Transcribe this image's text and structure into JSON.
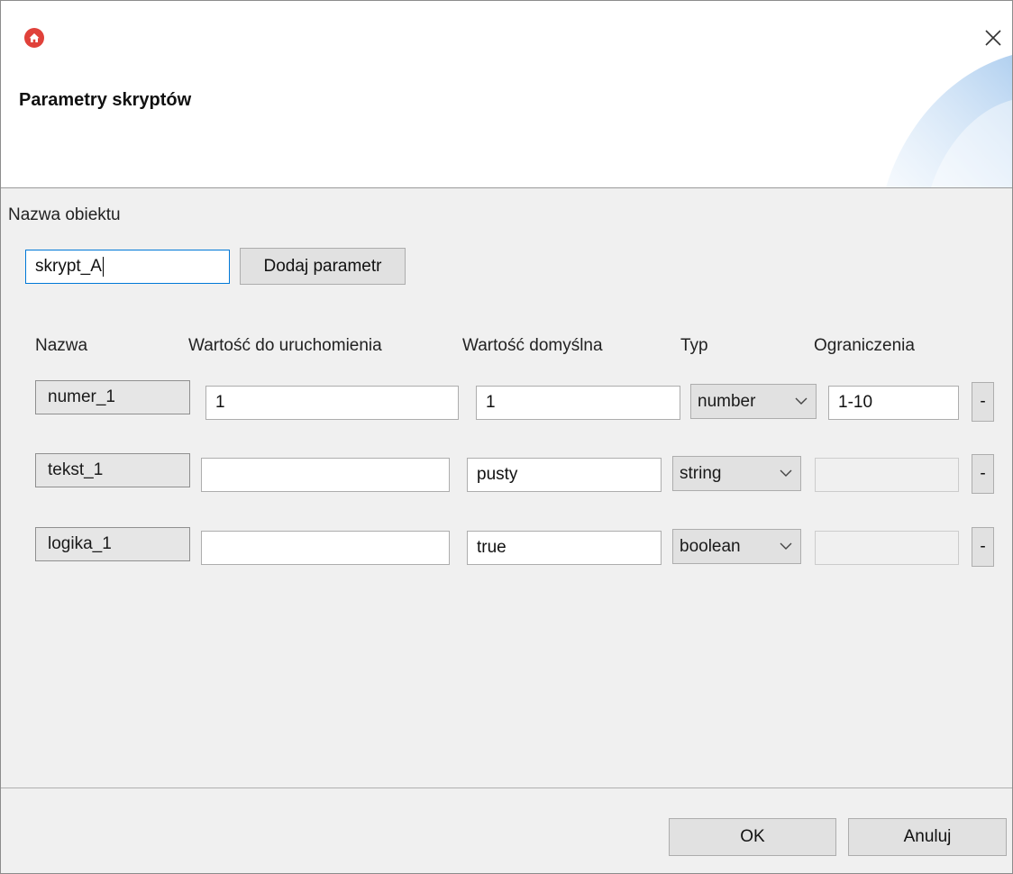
{
  "dialog": {
    "title": "Parametry skryptów",
    "close_glyph": "✕",
    "app_icon": "home-icon",
    "accent_color": "#e0413a"
  },
  "object": {
    "label": "Nazwa obiektu",
    "value": "skrypt_A",
    "add_button_label": "Dodaj parametr"
  },
  "columns": {
    "name": "Nazwa",
    "run_value": "Wartość do uruchomienia",
    "default_value": "Wartość domyślna",
    "type": "Typ",
    "constraints": "Ograniczenia"
  },
  "params": [
    {
      "name": "numer_1",
      "run_value": "1",
      "default_value": "1",
      "type": "number",
      "constraints": "1-10",
      "constraints_enabled": true,
      "remove_label": "-"
    },
    {
      "name": "tekst_1",
      "run_value": "",
      "default_value": "pusty",
      "type": "string",
      "constraints": "",
      "constraints_enabled": false,
      "remove_label": "-"
    },
    {
      "name": "logika_1",
      "run_value": "",
      "default_value": "true",
      "type": "boolean",
      "constraints": "",
      "constraints_enabled": false,
      "remove_label": "-"
    }
  ],
  "footer": {
    "ok_label": "OK",
    "cancel_label": "Anuluj"
  }
}
